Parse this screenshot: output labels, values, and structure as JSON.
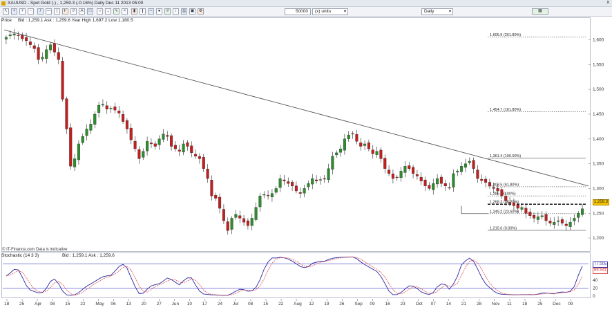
{
  "window": {
    "title": "XAUUSD - Spot Gold (-) , 1,259.3 (-0.16%)    Daily  Dec 11 2013 05:00"
  },
  "toolbar": {
    "quantity_value": "50000",
    "units_label": "(x) units",
    "timeframe_value": "Daily",
    "close_label": "x",
    "dropdown_arrow": "▾"
  },
  "price_panel": {
    "tag": "Price",
    "info": "Bid : 1,259.1 Ask : 1,259.6 Year High 1,697.2 Low 1,180.5",
    "watermark": "© IT-Finance.com  Data is indicative",
    "current_price_label": "1,259.3",
    "line_price_label": "1,268.3",
    "y_ticks": [
      "1,600",
      "1,550",
      "1,500",
      "1,450",
      "1,400",
      "1,350",
      "1,300",
      "1,250",
      "1,200"
    ]
  },
  "osc_panel": {
    "tag": "Stochastic (14 3 3)",
    "info": "Bid : 1,259.1 Ask : 1,259.6",
    "y_ticks": [
      "80",
      "60",
      "40",
      "20",
      "0"
    ],
    "k_value": "77.005",
    "d_value": "66.541"
  },
  "x_axis": {
    "labels": [
      "18",
      "25",
      "Apr",
      "08",
      "15",
      "22",
      "May",
      "06",
      "13",
      "20",
      "27",
      "Jun",
      "10",
      "17",
      "24",
      "Jul",
      "08",
      "15",
      "22",
      "Aug",
      "12",
      "19",
      "26",
      "Sep",
      "09",
      "16",
      "23",
      "Oct",
      "07",
      "14",
      "21",
      "28",
      "Nov",
      "11",
      "18",
      "25",
      "Dec",
      "09"
    ]
  },
  "fib_levels": [
    {
      "label": "1,605.9 (261.80%)",
      "value": 1605.9
    },
    {
      "label": "1,454.7 (161.80%)",
      "value": 1454.7
    },
    {
      "label": "1,361.4 (100.00%)",
      "value": 1361.4
    },
    {
      "label": "1,303.5 (61.80%)",
      "value": 1303.5
    },
    {
      "label": "1,285 (50.00%)",
      "value": 1285
    },
    {
      "label": "1,268.3 (38.20%)",
      "value": 1268.3
    },
    {
      "label": "1,249.2 (23.60%)",
      "value": 1249.2
    },
    {
      "label": "1,215.6 (0.00%)",
      "value": 1215.6
    }
  ],
  "chart_data": {
    "type": "candlestick",
    "symbol": "XAUUSD",
    "ylim": [
      1175,
      1630
    ],
    "closes_approx": [
      1605,
      1610,
      1612,
      1608,
      1602,
      1598,
      1590,
      1582,
      1560,
      1565,
      1580,
      1590,
      1575,
      1560,
      1480,
      1420,
      1345,
      1360,
      1390,
      1405,
      1420,
      1430,
      1450,
      1468,
      1470,
      1460,
      1462,
      1458,
      1452,
      1435,
      1420,
      1398,
      1380,
      1360,
      1375,
      1395,
      1390,
      1385,
      1400,
      1410,
      1405,
      1385,
      1380,
      1375,
      1390,
      1385,
      1372,
      1365,
      1360,
      1340,
      1320,
      1285,
      1280,
      1260,
      1235,
      1215,
      1240,
      1248,
      1240,
      1232,
      1225,
      1240,
      1262,
      1285,
      1288,
      1285,
      1290,
      1300,
      1320,
      1315,
      1310,
      1305,
      1295,
      1290,
      1300,
      1310,
      1320,
      1315,
      1318,
      1320,
      1340,
      1365,
      1372,
      1380,
      1400,
      1408,
      1410,
      1395,
      1385,
      1390,
      1380,
      1370,
      1375,
      1360,
      1340,
      1330,
      1320,
      1322,
      1335,
      1345,
      1340,
      1330,
      1325,
      1315,
      1305,
      1300,
      1310,
      1320,
      1310,
      1305,
      1302,
      1330,
      1335,
      1345,
      1350,
      1355,
      1340,
      1320,
      1316,
      1312,
      1305,
      1300,
      1295,
      1285,
      1275,
      1270,
      1265,
      1260,
      1262,
      1250,
      1245,
      1240,
      1243,
      1245,
      1235,
      1230,
      1232,
      1235,
      1230,
      1225,
      1232,
      1240,
      1250,
      1259
    ],
    "fib_levels": [
      1605.9,
      1454.7,
      1361.4,
      1303.5,
      1285,
      1268.3,
      1249.2,
      1215.6
    ],
    "trendline": {
      "start_value": 1620,
      "end_value": 1305
    },
    "oscillator": {
      "name": "Stochastic",
      "params": "14 3 3",
      "range": [
        0,
        100
      ],
      "bands": [
        20,
        80
      ]
    }
  },
  "colors": {
    "up": "#2e8b2e",
    "down": "#c02020",
    "k_line": "#3a3aa8",
    "d_line": "#e05050",
    "band": "#5a5ad0",
    "price_badge": "#f2c200",
    "fib": "#444444",
    "trend": "#555555"
  }
}
